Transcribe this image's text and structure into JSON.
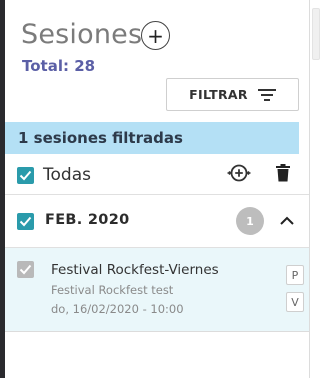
{
  "header": {
    "title": "Sesiones",
    "add_label": "+",
    "total_label": "Total: 28"
  },
  "filter": {
    "button_label": "FILTRAR",
    "filtered_text": "1 sesiones filtradas"
  },
  "select_all": {
    "label": "Todas",
    "checked": true
  },
  "group": {
    "label": "FEB. 2020",
    "count": "1",
    "checked": true
  },
  "sessions": [
    {
      "title": "Festival Rockfest-Viernes",
      "subtitle": "Festival Rockfest test",
      "date": "do, 16/02/2020 - 10:00",
      "tags": [
        "P",
        "V"
      ],
      "checked": true
    }
  ],
  "colors": {
    "accent": "#2a9bab",
    "total_text": "#5b5fa6",
    "filtered_bar": "#b4e0f5",
    "selected_row": "#eaf7fa"
  },
  "icons": {
    "add": "plus-circle-icon",
    "filter": "filter-lines-icon",
    "add_to": "circle-plus-arrows-icon",
    "delete": "trash-icon",
    "collapse": "chevron-up-icon",
    "check": "check-icon"
  }
}
